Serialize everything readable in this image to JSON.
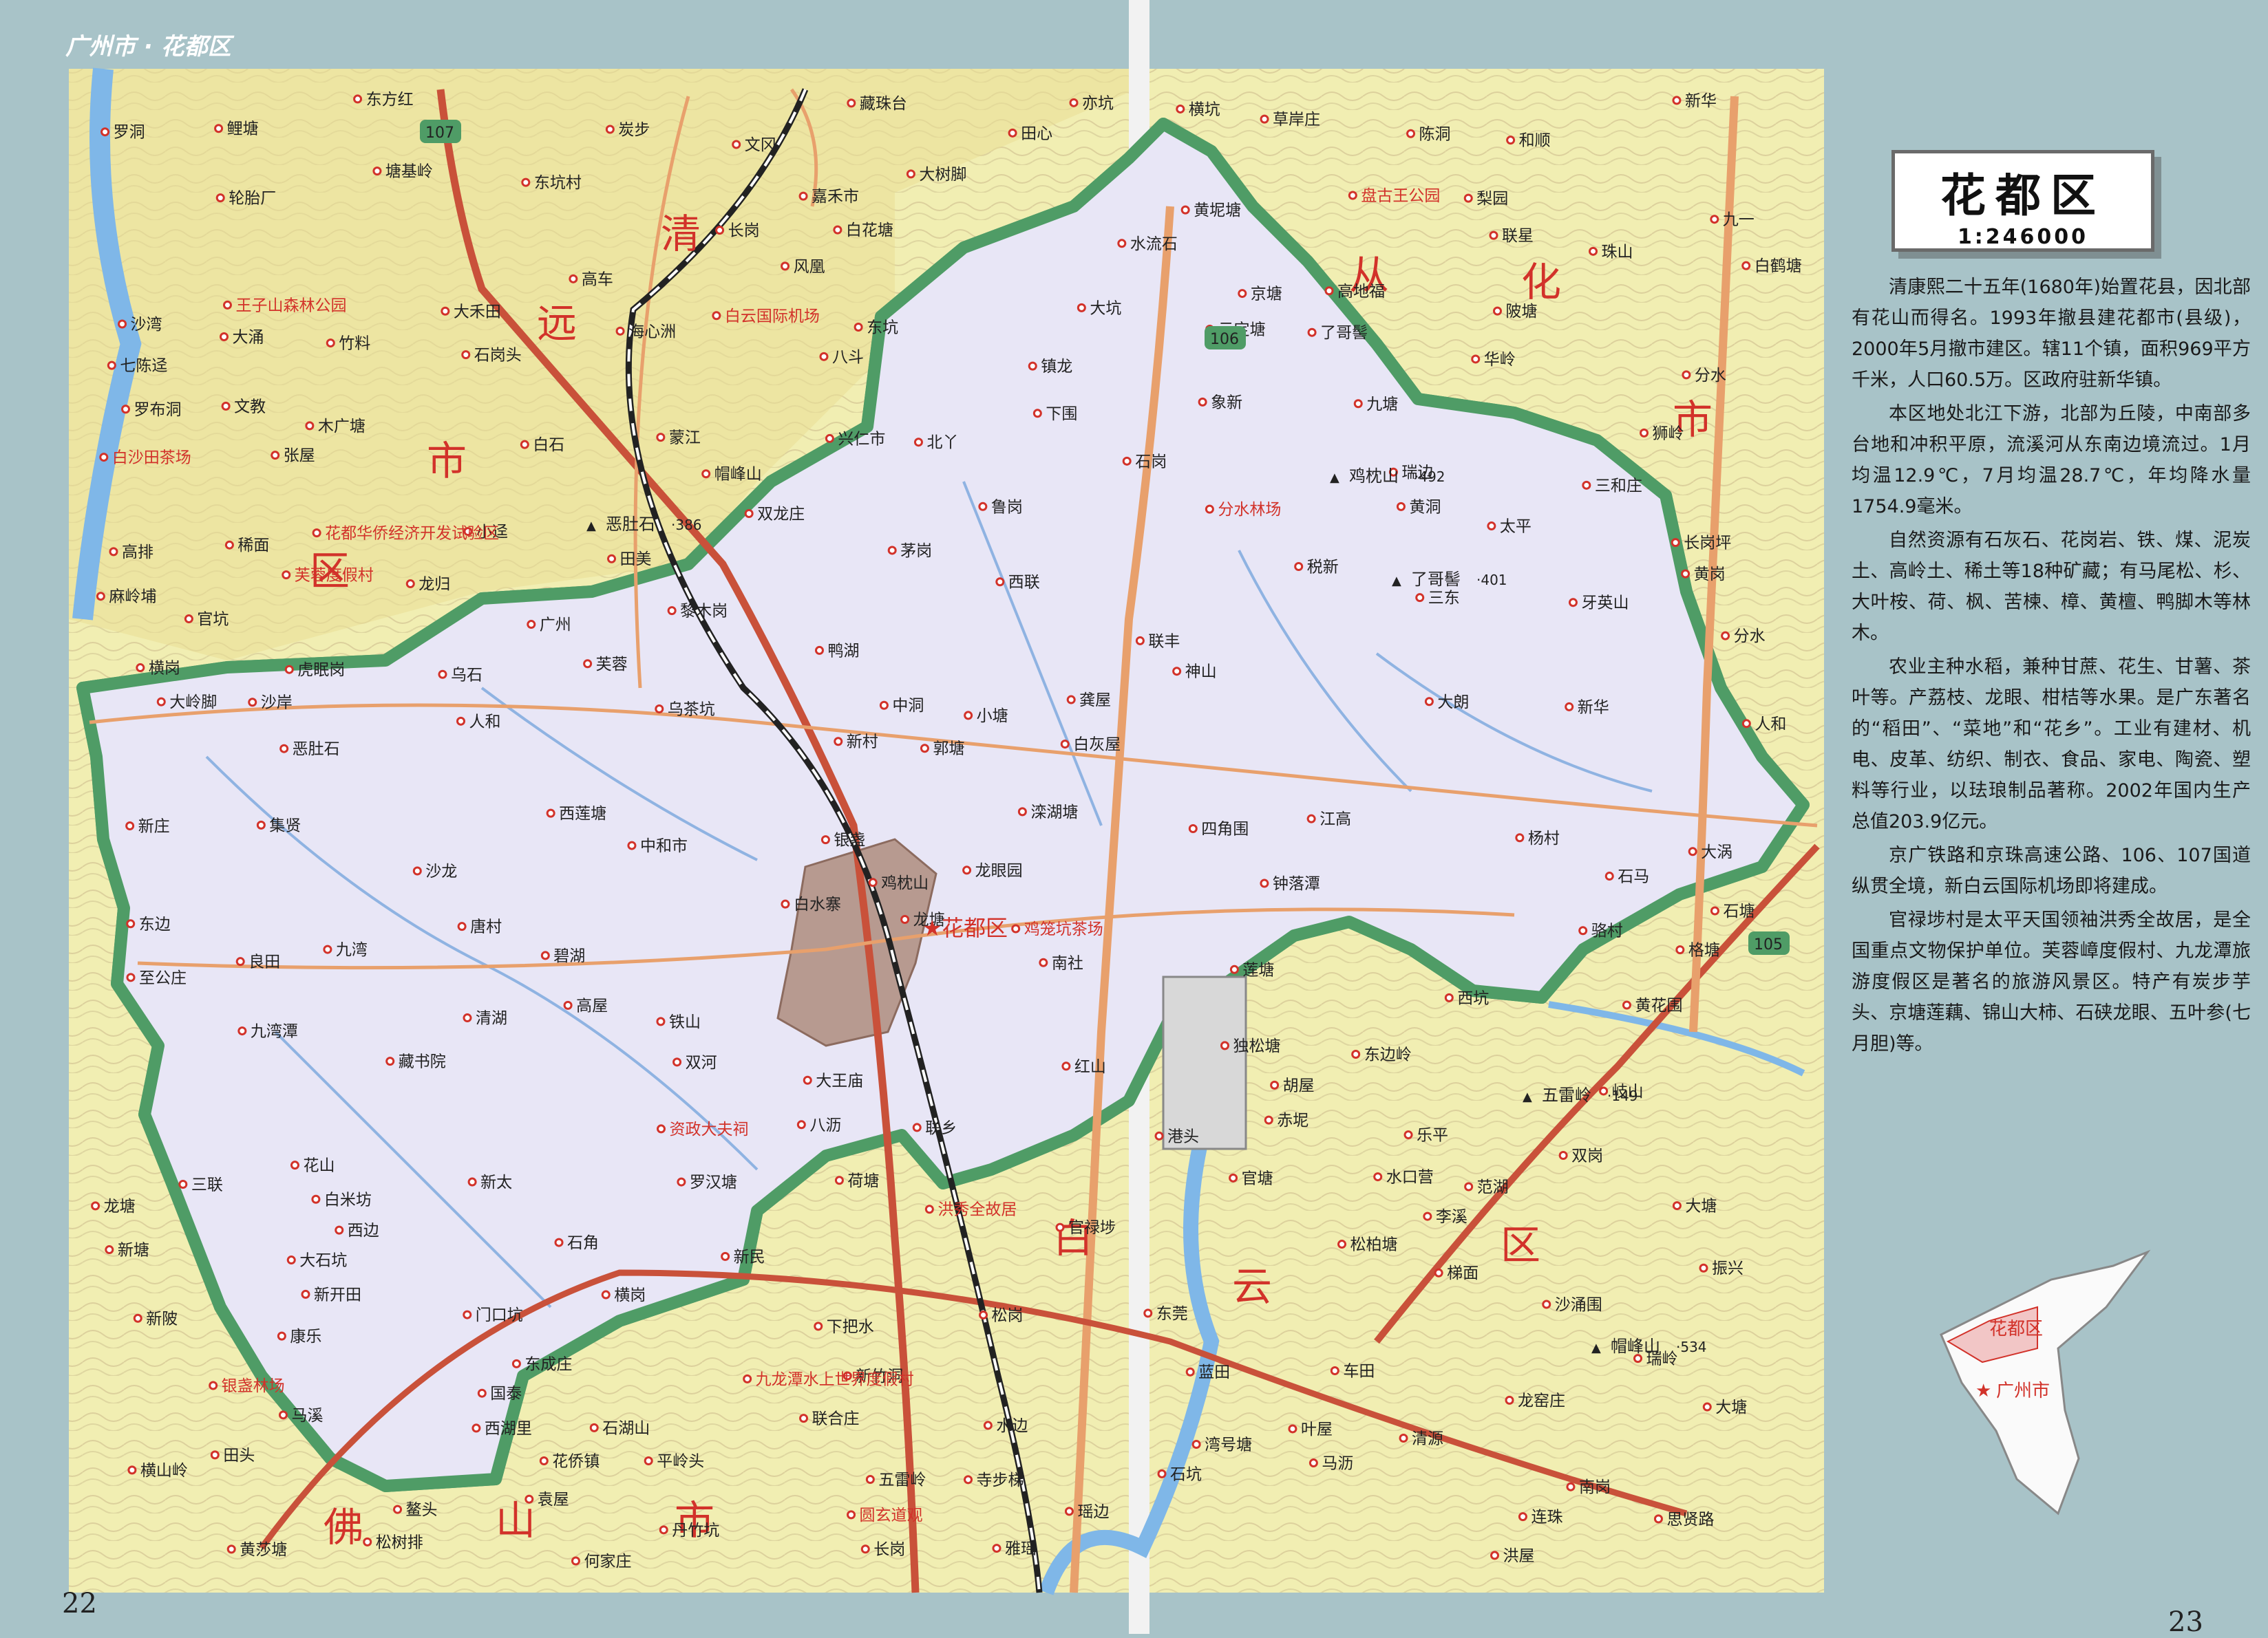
{
  "header": {
    "text": "广州市 · 花都区"
  },
  "page_numbers": {
    "left": "22",
    "right": "23"
  },
  "title": {
    "name": "花都区",
    "scale": "1:246000"
  },
  "description": [
    "清康熙二十五年(1680年)始置花县，因北部有花山而得名。1993年撤县建花都市(县级)，2000年5月撤市建区。辖11个镇，面积969平方千米，人口60.5万。区政府驻新华镇。",
    "本区地处北江下游，北部为丘陵，中南部多台地和冲积平原，流溪河从东南边境流过。1月均温12.9℃，7月均温28.7℃，年均降水量1754.9毫米。",
    "自然资源有石灰石、花岗岩、铁、煤、泥炭土、高岭土、稀土等18种矿藏；有马尾松、杉、大叶桉、荷、枫、苦楝、樟、黄檀、鸭脚木等林木。",
    "农业主种水稻，兼种甘蔗、花生、甘薯、茶叶等。产荔枝、龙眼、柑桔等水果。是广东著名的“稻田”、“菜地”和“花乡”。工业有建材、机电、皮革、纺织、制衣、食品、家电、陶瓷、塑料等行业，以珐琅制品著称。2002年国内生产总值203.9亿元。",
    "京广铁路和京珠高速公路、106、107国道纵贯全境，新白云国际机场即将建成。",
    "官禄埗村是太平天国领袖洪秀全故居，是全国重点文物保护单位。芙蓉嶂度假村、九龙潭旅游度假区是著名的旅游风景区。特产有炭步芋头、京塘莲藕、锦山大柿、石硖龙眼、五叶参(七月胆)等。"
  ],
  "inset": {
    "district": "花都区",
    "city": "广州市"
  },
  "regions": [
    "清",
    "远",
    "市",
    "区",
    "从",
    "化",
    "市",
    "白",
    "云",
    "区",
    "佛",
    "山",
    "市"
  ],
  "seat": "花都区",
  "towns": [
    "龙塘",
    "张屋",
    "银盏",
    "银盏林场",
    "龚屋",
    "石角",
    "黄坭塘",
    "北丫",
    "云定塘",
    "滦湖塘",
    "塘基岭",
    "思贤路",
    "恶肚石",
    "分水",
    "白水寨",
    "分水林场",
    "松树排",
    "兴仁市",
    "西联",
    "西边",
    "黎木岗",
    "田头",
    "国泰",
    "东边岭",
    "木广塘",
    "白花塘",
    "大岭脚",
    "独松塘",
    "黄岗",
    "下把水",
    "新村",
    "白石",
    "高地福",
    "连珠",
    "瑞岭",
    "田心",
    "乌石",
    "官塘",
    "袁屋",
    "白灰屋",
    "黄莎塘",
    "新竹洞",
    "大石坑",
    "三和庄",
    "沙湾",
    "赤坭",
    "蓝田",
    "门口坑",
    "鲤塘",
    "松岗",
    "陂塘",
    "大树脚",
    "西莲塘",
    "官坑",
    "小迳",
    "东方红",
    "中洞",
    "龙塘",
    "荷塘",
    "平岭头",
    "广州",
    "轮胎厂",
    "至公庄",
    "鸭湖",
    "水边",
    "小塘",
    "马溪",
    "四角围",
    "岐山",
    "圆玄道观",
    "新华",
    "联乡",
    "清源",
    "雅瑶",
    "东莞",
    "石塘",
    "神山",
    "松柏塘",
    "郭塘",
    "双岗",
    "长岗",
    "沙龙",
    "炭步",
    "大涡",
    "横岗",
    "藏书院",
    "新太",
    "石湖山",
    "华岭",
    "乌茶坑",
    "骆村",
    "大涌",
    "三联",
    "珠山",
    "文冈",
    "花山",
    "和顺",
    "鲁岗",
    "蒙江",
    "江高",
    "清湖",
    "南岗",
    "大朗",
    "文教",
    "瑶边",
    "海心洲",
    "黄花围",
    "乐平",
    "碧湖",
    "鸡笼坑茶场",
    "虎眠岗",
    "范湖",
    "龙眼园",
    "王子山森林公园",
    "牙英山",
    "丹竹坑",
    "西坑",
    "东坑",
    "茅岗",
    "下围",
    "红山",
    "藏珠台",
    "水流石",
    "稀面",
    "大王庙",
    "洪屋",
    "高排",
    "联丰",
    "大坑",
    "白沙田茶场",
    "芙蓉度假村",
    "寺步梯",
    "沙岸",
    "横岗",
    "罗汉塘",
    "瑞边",
    "集贤",
    "盘古王公园",
    "双龙庄",
    "税新",
    "新庄",
    "新塘",
    "八沥",
    "振兴",
    "狮岭",
    "芙蓉",
    "新民",
    "南社",
    "铁山",
    "长岗",
    "石岗",
    "联星",
    "车田",
    "横坑",
    "七陈迳",
    "何家庄",
    "罗洞",
    "唐村",
    "东边",
    "长岗坪",
    "草岸庄",
    "洪秀全故居",
    "官禄埗",
    "大塘",
    "石岗头",
    "三东",
    "新华",
    "田美",
    "九塘",
    "资政大夫祠",
    "莲塘",
    "白鹤塘",
    "白云国际机场",
    "竹料",
    "良田",
    "中和市",
    "石马",
    "双河",
    "九龙潭水上世界度假村",
    "九湾潭",
    "东坑村",
    "黄洞",
    "湾号塘",
    "康乐",
    "梯面",
    "鸡枕山",
    "了哥髻",
    "新开田",
    "联合庄",
    "高车",
    "亦坑",
    "大禾田",
    "九一",
    "梨园",
    "风凰",
    "李溪",
    "花侨镇",
    "花都华侨经济开发试验区",
    "港头",
    "水口营",
    "京塘",
    "杨村",
    "镇龙",
    "太平",
    "钟落潭",
    "五雷岭",
    "马沥",
    "新陂",
    "陈洞",
    "大塘",
    "高屋",
    "帽峰山",
    "罗布洞",
    "八斗",
    "胡屋",
    "龙归",
    "石坑",
    "嘉禾市",
    "沙涌围",
    "人和",
    "白米坊",
    "东成庄",
    "龙窑庄",
    "鳌头",
    "西湖里",
    "麻岭埔",
    "象新",
    "分水",
    "叶屋",
    "人和",
    "格塘",
    "横山岭",
    "九湾"
  ],
  "peaks": [
    {
      "name": "恶肚石",
      "elev": "386"
    },
    {
      "name": "鸡枕山",
      "elev": "492"
    },
    {
      "name": "了哥髻",
      "elev": "401"
    },
    {
      "name": "五雷岭",
      "elev": "149"
    },
    {
      "name": "帽峰山",
      "elev": "534"
    }
  ],
  "roads": [
    "107",
    "106",
    "105"
  ],
  "colors": {
    "district": "#e8e6f6",
    "outside": "#f1eeb2",
    "border": "#4f9c66",
    "province_road": "#e8a06c",
    "national_road": "#c9513a",
    "water": "#7fb7e8",
    "urban": "#b79a90",
    "sidebar": "#a8c3c8"
  }
}
